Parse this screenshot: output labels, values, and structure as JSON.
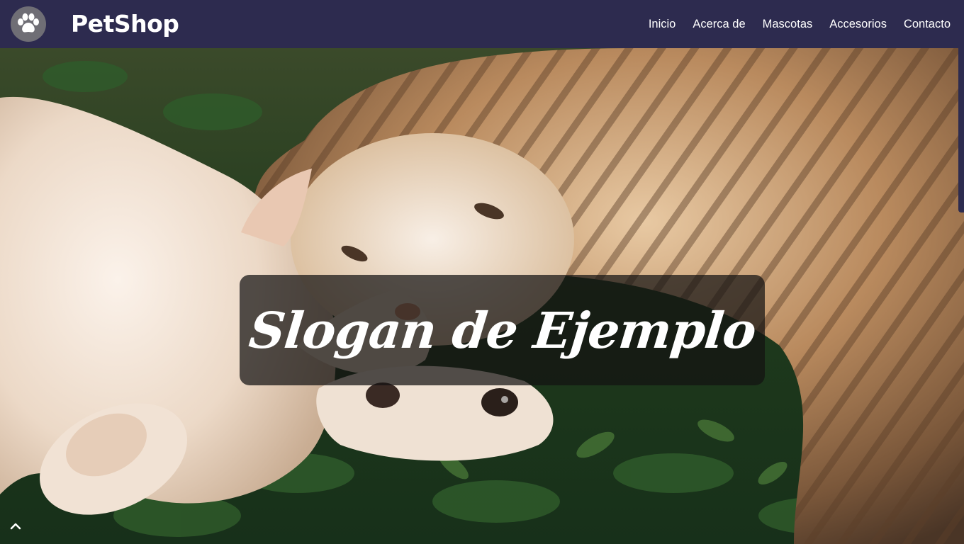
{
  "navbar": {
    "brand": "PetShop",
    "logo_icon": "paw-icon",
    "links": [
      {
        "label": "Inicio"
      },
      {
        "label": "Acerca de"
      },
      {
        "label": "Mascotas"
      },
      {
        "label": "Accesorios"
      },
      {
        "label": "Contacto"
      }
    ]
  },
  "hero": {
    "slogan": "Slogan de Ejemplo",
    "image_subject": "cat-and-dog-photo"
  },
  "scroll_top_icon": "chevron-up-icon",
  "colors": {
    "navbar_bg": "#2d2b4f",
    "slogan_box_bg": "rgba(20,18,18,0.72)",
    "text": "#ffffff"
  }
}
